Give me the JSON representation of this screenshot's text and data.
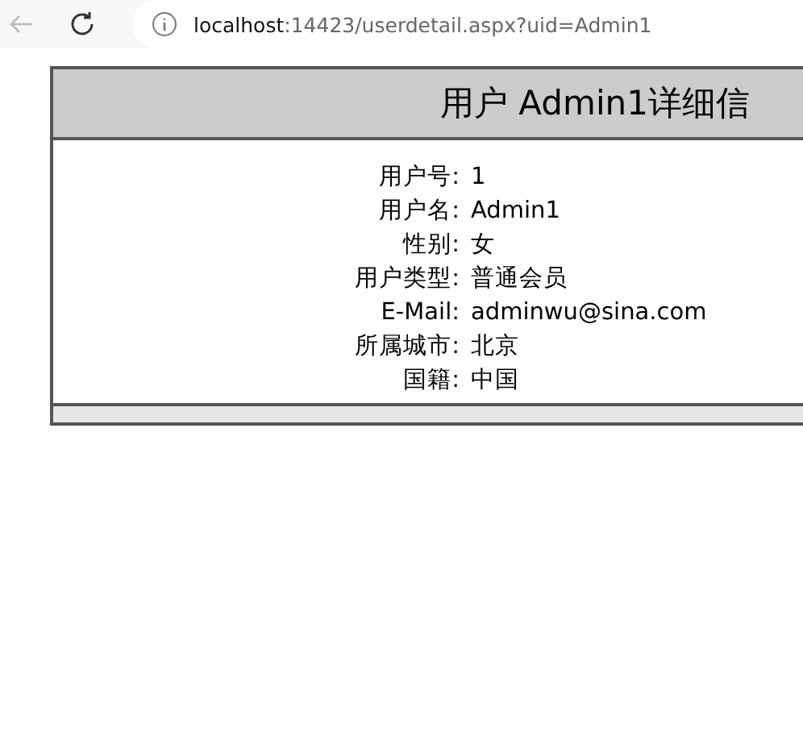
{
  "browser": {
    "url_host": "localhost",
    "url_rest": ":14423/userdetail.aspx?uid=Admin1"
  },
  "detail": {
    "title": "用户 Admin1详细信",
    "fields": [
      {
        "label": "用户号:",
        "value": "1"
      },
      {
        "label": "用户名:",
        "value": "Admin1"
      },
      {
        "label": "性别:",
        "value": "女"
      },
      {
        "label": "用户类型:",
        "value": "普通会员"
      },
      {
        "label": "E-Mail:",
        "value": "adminwu@sina.com"
      },
      {
        "label": "所属城市:",
        "value": "北京"
      },
      {
        "label": "国籍:",
        "value": "中国"
      }
    ]
  }
}
